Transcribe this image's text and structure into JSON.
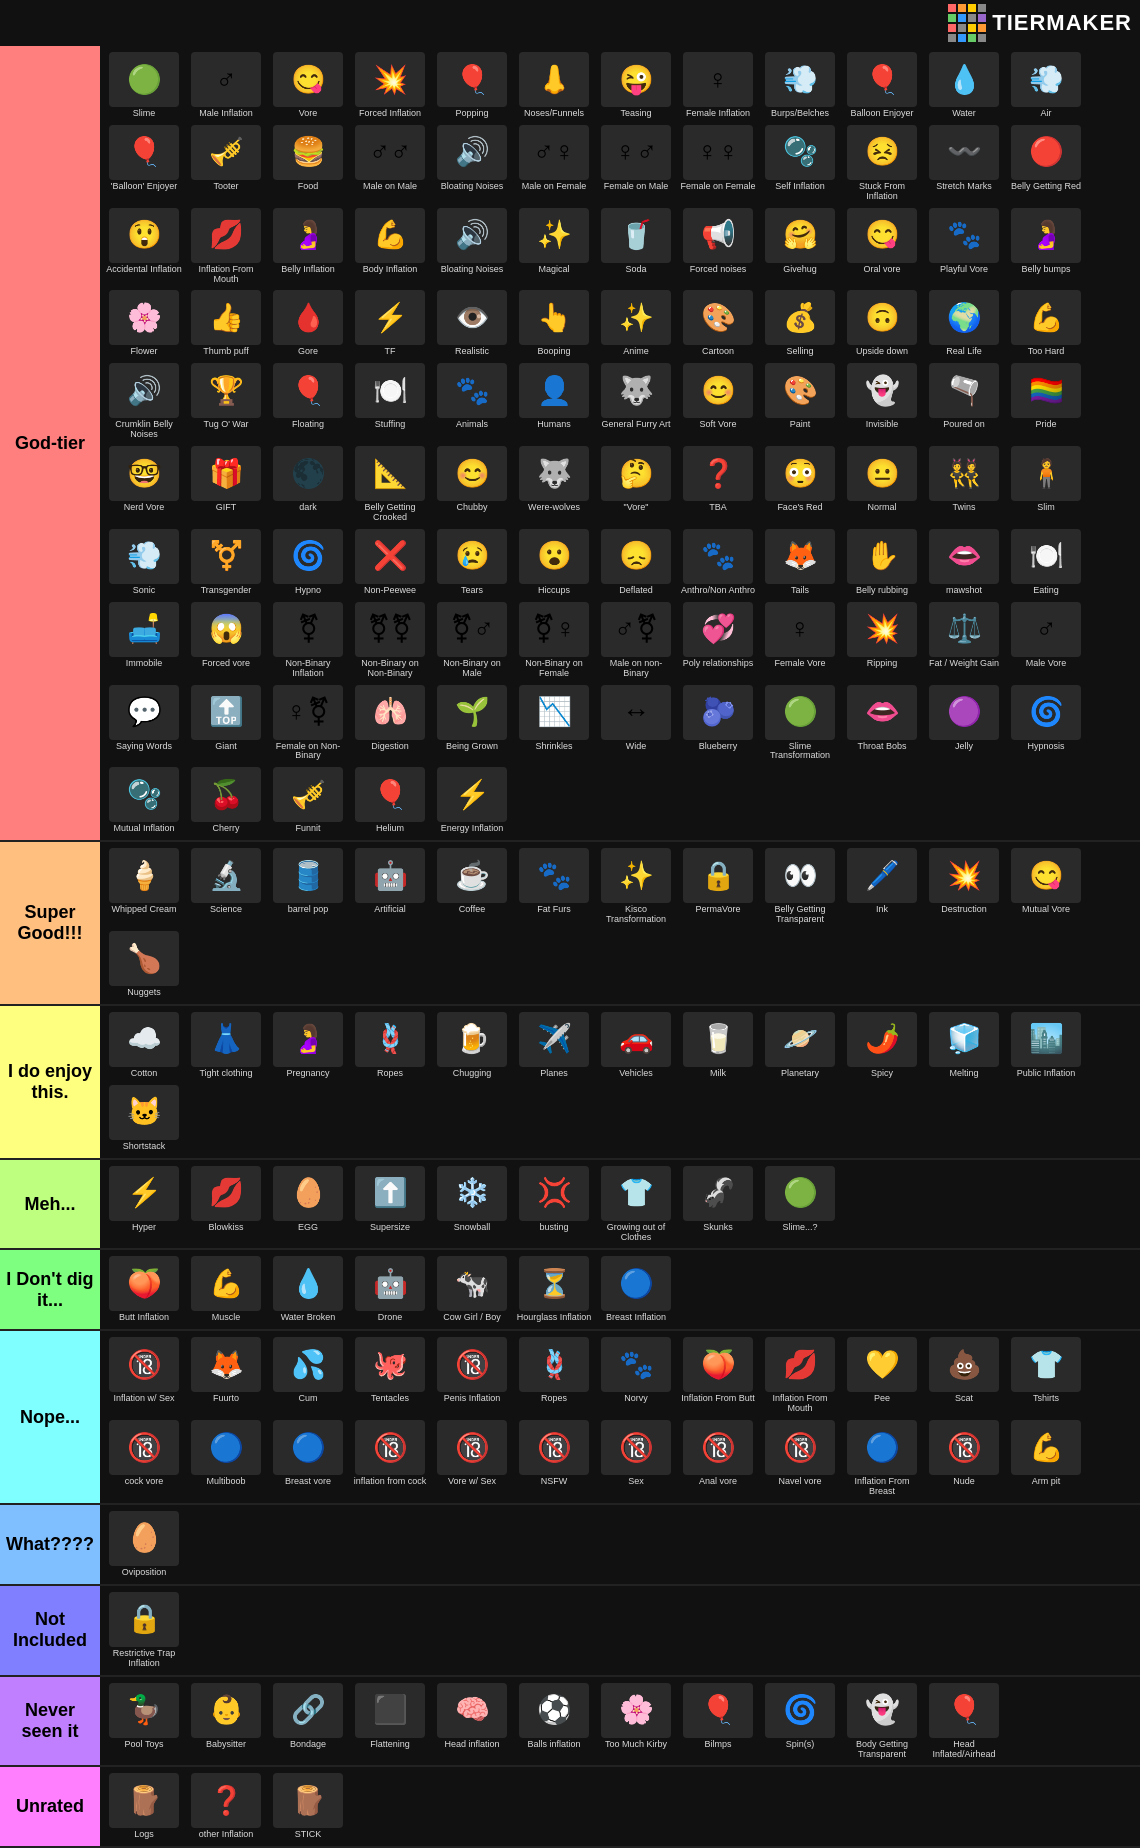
{
  "header": {
    "title": "TiERMAKER"
  },
  "tiers": [
    {
      "id": "god",
      "label": "God-tier",
      "color": "#ff7f7f",
      "items": [
        {
          "label": "Slime",
          "emoji": "🟢"
        },
        {
          "label": "Male Inflation",
          "emoji": "♂️"
        },
        {
          "label": "Vore",
          "emoji": "😋"
        },
        {
          "label": "Forced Inflation",
          "emoji": "💥"
        },
        {
          "label": "Popping",
          "emoji": "🎈"
        },
        {
          "label": "Noses/Funnels",
          "emoji": "👃"
        },
        {
          "label": "Teasing",
          "emoji": "😜"
        },
        {
          "label": "Female Inflation",
          "emoji": "♀️"
        },
        {
          "label": "Burps/Belches",
          "emoji": "💨"
        },
        {
          "label": "Balloon Enjoyer",
          "emoji": "🎈"
        },
        {
          "label": "Water",
          "emoji": "💧"
        },
        {
          "label": "Air",
          "emoji": "💨"
        },
        {
          "label": "'Balloon' Enjoyer",
          "emoji": "🎈"
        },
        {
          "label": "Tooter",
          "emoji": "🎺"
        },
        {
          "label": "Food",
          "emoji": "🍔"
        },
        {
          "label": "Male on Male",
          "emoji": "♂️♂️"
        },
        {
          "label": "Bloating Noises",
          "emoji": "🔊"
        },
        {
          "label": "Male on Female",
          "emoji": "♂️♀️"
        },
        {
          "label": "Female on Male",
          "emoji": "♀️♂️"
        },
        {
          "label": "Female on Female",
          "emoji": "♀️♀️"
        },
        {
          "label": "Self Inflation",
          "emoji": "🫧"
        },
        {
          "label": "Stuck From Inflation",
          "emoji": "😣"
        },
        {
          "label": "Stretch Marks",
          "emoji": "〰️"
        },
        {
          "label": "Belly Getting Red",
          "emoji": "🔴"
        },
        {
          "label": "Accidental Inflation",
          "emoji": "😲"
        },
        {
          "label": "Inflation From Mouth",
          "emoji": "💋"
        },
        {
          "label": "Belly Inflation",
          "emoji": "🤰"
        },
        {
          "label": "Body Inflation",
          "emoji": "💪"
        },
        {
          "label": "Bloating Noises",
          "emoji": "🔊"
        },
        {
          "label": "Magical",
          "emoji": "✨"
        },
        {
          "label": "Soda",
          "emoji": "🥤"
        },
        {
          "label": "Forced noises",
          "emoji": "📢"
        },
        {
          "label": "Givehug",
          "emoji": "🤗"
        },
        {
          "label": "Oral vore",
          "emoji": "😋"
        },
        {
          "label": "Playful Vore",
          "emoji": "🐾"
        },
        {
          "label": "Belly bumps",
          "emoji": "🤰"
        },
        {
          "label": "Flower",
          "emoji": "🌸"
        },
        {
          "label": "Thumb puff",
          "emoji": "👍"
        },
        {
          "label": "Gore",
          "emoji": "🩸"
        },
        {
          "label": "TF",
          "emoji": "⚡"
        },
        {
          "label": "Realistic",
          "emoji": "👁️"
        },
        {
          "label": "Booping",
          "emoji": "👆"
        },
        {
          "label": "Anime",
          "emoji": "✨"
        },
        {
          "label": "Cartoon",
          "emoji": "🎨"
        },
        {
          "label": "Selling",
          "emoji": "💰"
        },
        {
          "label": "Upside down",
          "emoji": "🙃"
        },
        {
          "label": "Real Life",
          "emoji": "🌍"
        },
        {
          "label": "Too Hard",
          "emoji": "💪"
        },
        {
          "label": "Crumklin Belly Noises",
          "emoji": "🔊"
        },
        {
          "label": "Tug O' War",
          "emoji": "🏆"
        },
        {
          "label": "Floating",
          "emoji": "🎈"
        },
        {
          "label": "Stuffing",
          "emoji": "🍽️"
        },
        {
          "label": "Animals",
          "emoji": "🐾"
        },
        {
          "label": "Humans",
          "emoji": "👤"
        },
        {
          "label": "General Furry Art",
          "emoji": "🐺"
        },
        {
          "label": "Soft Vore",
          "emoji": "😊"
        },
        {
          "label": "Paint",
          "emoji": "🎨"
        },
        {
          "label": "Invisible",
          "emoji": "👻"
        },
        {
          "label": "Poured on",
          "emoji": "🫗"
        },
        {
          "label": "Pride",
          "emoji": "🏳️‍🌈"
        },
        {
          "label": "Nerd Vore",
          "emoji": "🤓"
        },
        {
          "label": "GIFT",
          "emoji": "🎁"
        },
        {
          "label": "dark",
          "emoji": "🌑"
        },
        {
          "label": "Belly Getting Crooked",
          "emoji": "📐"
        },
        {
          "label": "Chubby",
          "emoji": "😊"
        },
        {
          "label": "Were-wolves",
          "emoji": "🐺"
        },
        {
          "label": "\"Vore\"",
          "emoji": "🤔"
        },
        {
          "label": "TBA",
          "emoji": "❓"
        },
        {
          "label": "Face's Red",
          "emoji": "😳"
        },
        {
          "label": "Normal",
          "emoji": "😐"
        },
        {
          "label": "Twins",
          "emoji": "👯"
        },
        {
          "label": "Slim",
          "emoji": "🧍"
        },
        {
          "label": "Sonic",
          "emoji": "💨"
        },
        {
          "label": "Transgender",
          "emoji": "⚧️"
        },
        {
          "label": "Hypno",
          "emoji": "🌀"
        },
        {
          "label": "Non-Peewee",
          "emoji": "❌"
        },
        {
          "label": "Tears",
          "emoji": "😢"
        },
        {
          "label": "Hiccups",
          "emoji": "😮"
        },
        {
          "label": "Deflated",
          "emoji": "😞"
        },
        {
          "label": "Anthro/Non Anthro",
          "emoji": "🐾"
        },
        {
          "label": "Tails",
          "emoji": "🦊"
        },
        {
          "label": "Belly rubbing",
          "emoji": "✋"
        },
        {
          "label": "mawshot",
          "emoji": "👄"
        },
        {
          "label": "Eating",
          "emoji": "🍽️"
        },
        {
          "label": "Immobile",
          "emoji": "🛋️"
        },
        {
          "label": "Forced vore",
          "emoji": "😱"
        },
        {
          "label": "Non-Binary Inflation",
          "emoji": "⚧"
        },
        {
          "label": "Non-Binary on Non-Binary",
          "emoji": "⚧⚧"
        },
        {
          "label": "Non-Binary on Male",
          "emoji": "⚧♂"
        },
        {
          "label": "Non-Binary on Female",
          "emoji": "⚧♀"
        },
        {
          "label": "Male on non-Binary",
          "emoji": "♂⚧"
        },
        {
          "label": "Poly relationships",
          "emoji": "💞"
        },
        {
          "label": "Female Vore",
          "emoji": "♀️"
        },
        {
          "label": "Ripping",
          "emoji": "💥"
        },
        {
          "label": "Fat / Weight Gain",
          "emoji": "⚖️"
        },
        {
          "label": "Male Vore",
          "emoji": "♂️"
        },
        {
          "label": "Saying Words",
          "emoji": "💬"
        },
        {
          "label": "Giant",
          "emoji": "🔝"
        },
        {
          "label": "Female on Non-Binary",
          "emoji": "♀️⚧"
        },
        {
          "label": "Digestion",
          "emoji": "🫁"
        },
        {
          "label": "Being Grown",
          "emoji": "🌱"
        },
        {
          "label": "Shrinkles",
          "emoji": "📉"
        },
        {
          "label": "Wide",
          "emoji": "↔️"
        },
        {
          "label": "Blueberry",
          "emoji": "🫐"
        },
        {
          "label": "Slime Transformation",
          "emoji": "🟢"
        },
        {
          "label": "Throat Bobs",
          "emoji": "👄"
        },
        {
          "label": "Jelly",
          "emoji": "🟣"
        },
        {
          "label": "Hypnosis",
          "emoji": "🌀"
        },
        {
          "label": "Mutual Inflation",
          "emoji": "🫧"
        },
        {
          "label": "Cherry",
          "emoji": "🍒"
        },
        {
          "label": "Funnit",
          "emoji": "🎺"
        },
        {
          "label": "Helium",
          "emoji": "🎈"
        },
        {
          "label": "Energy Inflation",
          "emoji": "⚡"
        }
      ]
    },
    {
      "id": "supergood",
      "label": "Super Good!!!",
      "color": "#ffbf7f",
      "items": [
        {
          "label": "Whipped Cream",
          "emoji": "🍦"
        },
        {
          "label": "Science",
          "emoji": "🔬"
        },
        {
          "label": "barrel pop",
          "emoji": "🛢️"
        },
        {
          "label": "Artificial",
          "emoji": "🤖"
        },
        {
          "label": "Coffee",
          "emoji": "☕"
        },
        {
          "label": "Fat Furs",
          "emoji": "🐾"
        },
        {
          "label": "Kisco Transformation",
          "emoji": "✨"
        },
        {
          "label": "PermaVore",
          "emoji": "🔒"
        },
        {
          "label": "Belly Getting Transparent",
          "emoji": "👀"
        },
        {
          "label": "Ink",
          "emoji": "🖊️"
        },
        {
          "label": "Destruction",
          "emoji": "💥"
        },
        {
          "label": "Mutual Vore",
          "emoji": "😋"
        },
        {
          "label": "Nuggets",
          "emoji": "🍗"
        }
      ]
    },
    {
      "id": "enjoy",
      "label": "I do enjoy this.",
      "color": "#ffff7f",
      "items": [
        {
          "label": "Cotton",
          "emoji": "☁️"
        },
        {
          "label": "Tight clothing",
          "emoji": "👗"
        },
        {
          "label": "Pregnancy",
          "emoji": "🤰"
        },
        {
          "label": "Ropes",
          "emoji": "🪢"
        },
        {
          "label": "Chugging",
          "emoji": "🍺"
        },
        {
          "label": "Planes",
          "emoji": "✈️"
        },
        {
          "label": "Vehicles",
          "emoji": "🚗"
        },
        {
          "label": "Milk",
          "emoji": "🥛"
        },
        {
          "label": "Planetary",
          "emoji": "🪐"
        },
        {
          "label": "Spicy",
          "emoji": "🌶️"
        },
        {
          "label": "Melting",
          "emoji": "🧊"
        },
        {
          "label": "Public Inflation",
          "emoji": "🏙️"
        },
        {
          "label": "Shortstack",
          "emoji": "🐱"
        }
      ]
    },
    {
      "id": "meh",
      "label": "Meh...",
      "color": "#bfff7f",
      "items": [
        {
          "label": "Hyper",
          "emoji": "⚡"
        },
        {
          "label": "Blowkiss",
          "emoji": "💋"
        },
        {
          "label": "EGG",
          "emoji": "🥚"
        },
        {
          "label": "Supersize",
          "emoji": "⬆️"
        },
        {
          "label": "Snowball",
          "emoji": "❄️"
        },
        {
          "label": "busting",
          "emoji": "💢"
        },
        {
          "label": "Growing out of Clothes",
          "emoji": "👕"
        },
        {
          "label": "Skunks",
          "emoji": "🦨"
        },
        {
          "label": "Slime...?",
          "emoji": "🟢"
        }
      ]
    },
    {
      "id": "dontdig",
      "label": "I Don't dig it...",
      "color": "#7fff7f",
      "items": [
        {
          "label": "Butt Inflation",
          "emoji": "🍑"
        },
        {
          "label": "Muscle",
          "emoji": "💪"
        },
        {
          "label": "Water Broken",
          "emoji": "💧"
        },
        {
          "label": "Drone",
          "emoji": "🤖"
        },
        {
          "label": "Cow Girl / Boy",
          "emoji": "🐄"
        },
        {
          "label": "Hourglass Inflation",
          "emoji": "⏳"
        },
        {
          "label": "Breast Inflation",
          "emoji": "🔵"
        }
      ]
    },
    {
      "id": "nope",
      "label": "Nope...",
      "color": "#7fffff",
      "items": [
        {
          "label": "Inflation w/ Sex",
          "emoji": "🔞"
        },
        {
          "label": "Fuurto",
          "emoji": "🦊"
        },
        {
          "label": "Cum",
          "emoji": "💦"
        },
        {
          "label": "Tentacles",
          "emoji": "🐙"
        },
        {
          "label": "Penis Inflation",
          "emoji": "🔞"
        },
        {
          "label": "Ropes",
          "emoji": "🪢"
        },
        {
          "label": "Norvy",
          "emoji": "🐾"
        },
        {
          "label": "Inflation From Butt",
          "emoji": "🍑"
        },
        {
          "label": "Inflation From Mouth",
          "emoji": "💋"
        },
        {
          "label": "Pee",
          "emoji": "💛"
        },
        {
          "label": "Scat",
          "emoji": "💩"
        },
        {
          "label": "Tshirts",
          "emoji": "👕"
        },
        {
          "label": "cock vore",
          "emoji": "🔞"
        },
        {
          "label": "Multiboob",
          "emoji": "🔵"
        },
        {
          "label": "Breast vore",
          "emoji": "🔵"
        },
        {
          "label": "inflation from cock",
          "emoji": "🔞"
        },
        {
          "label": "Vore w/ Sex",
          "emoji": "🔞"
        },
        {
          "label": "NSFW",
          "emoji": "🔞"
        },
        {
          "label": "Sex",
          "emoji": "🔞"
        },
        {
          "label": "Anal vore",
          "emoji": "🔞"
        },
        {
          "label": "Navel vore",
          "emoji": "🔞"
        },
        {
          "label": "Inflation From Breast",
          "emoji": "🔵"
        },
        {
          "label": "Nude",
          "emoji": "🔞"
        },
        {
          "label": "Arm pit",
          "emoji": "💪"
        }
      ]
    },
    {
      "id": "what",
      "label": "What????",
      "color": "#7fbfff",
      "items": [
        {
          "label": "Oviposition",
          "emoji": "🥚"
        }
      ]
    },
    {
      "id": "notincluded",
      "label": "Not Included",
      "color": "#7f7fff",
      "items": [
        {
          "label": "Restrictive Trap Inflation",
          "emoji": "🔒"
        }
      ]
    },
    {
      "id": "neverseen",
      "label": "Never seen it",
      "color": "#bf7fff",
      "items": [
        {
          "label": "Pool Toys",
          "emoji": "🦆"
        },
        {
          "label": "Babysitter",
          "emoji": "👶"
        },
        {
          "label": "Bondage",
          "emoji": "🔗"
        },
        {
          "label": "Flattening",
          "emoji": "⬛"
        },
        {
          "label": "Head inflation",
          "emoji": "🧠"
        },
        {
          "label": "Balls inflation",
          "emoji": "⚽"
        },
        {
          "label": "Too Much Kirby",
          "emoji": "🌸"
        },
        {
          "label": "Bilmps",
          "emoji": "🎈"
        },
        {
          "label": "Spin(s)",
          "emoji": "🌀"
        },
        {
          "label": "Body Getting Transparent",
          "emoji": "👻"
        },
        {
          "label": "Head Inflated/Airhead",
          "emoji": "🎈"
        }
      ]
    },
    {
      "id": "unrated",
      "label": "Unrated",
      "color": "#ff7fff",
      "items": [
        {
          "label": "Logs",
          "emoji": "🪵"
        },
        {
          "label": "other Inflation",
          "emoji": "❓"
        },
        {
          "label": "STICK",
          "emoji": "🪵"
        }
      ]
    }
  ]
}
